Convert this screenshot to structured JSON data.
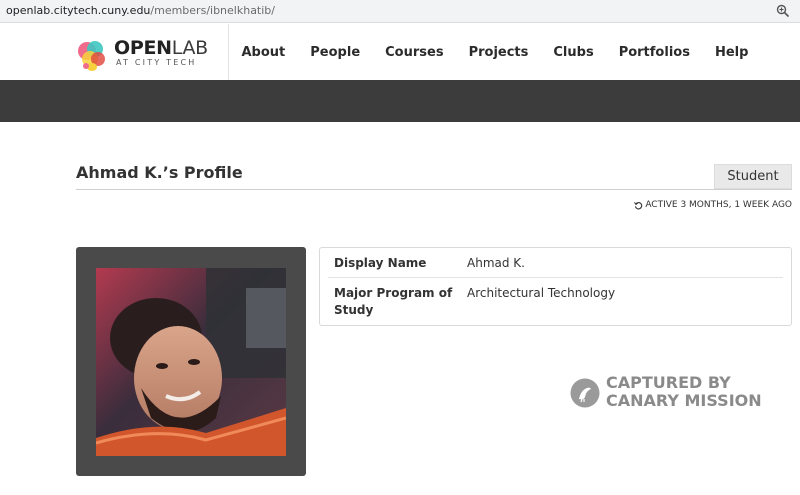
{
  "browser": {
    "url_host": "openlab.citytech.cuny.edu",
    "url_path": "/members/ibnelkhatib/",
    "zoom_icon": "zoom-icon"
  },
  "site": {
    "logo_open": "OPEN",
    "logo_lab": "LAB",
    "logo_sub": "AT CITY TECH",
    "nav": [
      "About",
      "People",
      "Courses",
      "Projects",
      "Clubs",
      "Portfolios",
      "Help"
    ]
  },
  "profile": {
    "title": "Ahmad K.’s Profile",
    "badge": "Student",
    "active": "ACTIVE 3 MONTHS, 1 WEEK AGO",
    "fields": [
      {
        "label": "Display Name",
        "value": "Ahmad K."
      },
      {
        "label": "Major Program of Study",
        "value": "Architectural Technology"
      }
    ]
  },
  "watermark": {
    "line1": "CAPTURED BY",
    "line2": "CANARY MISSION"
  },
  "colors": {
    "dark_band": "#3c3c3c",
    "avatar_frame": "#4a4a4a",
    "watermark": "#8a8a8a"
  }
}
